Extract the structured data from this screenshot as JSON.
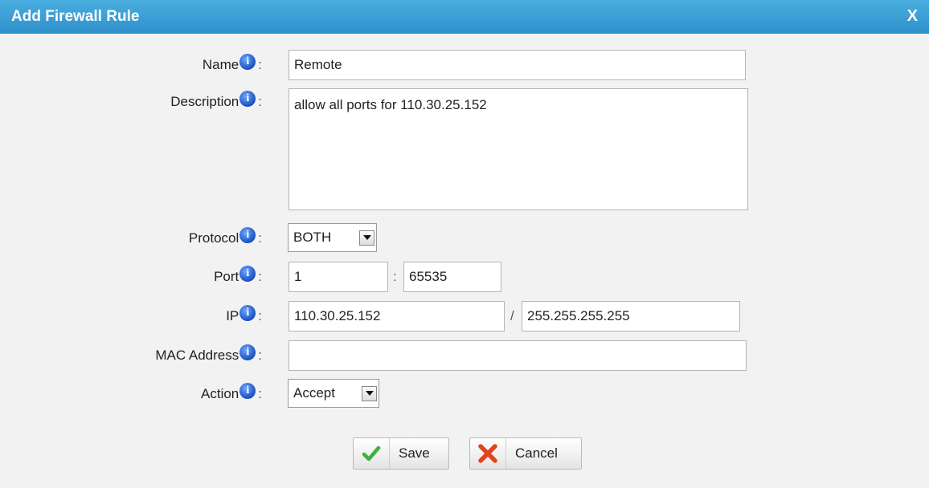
{
  "dialog": {
    "title": "Add Firewall Rule",
    "close_label": "X"
  },
  "form": {
    "name": {
      "label": "Name",
      "value": "Remote"
    },
    "description": {
      "label": "Description",
      "value": "allow all ports for 110.30.25.152"
    },
    "protocol": {
      "label": "Protocol",
      "value": "BOTH"
    },
    "port": {
      "label": "Port",
      "from": "1",
      "separator": ":",
      "to": "65535"
    },
    "ip": {
      "label": "IP",
      "address": "110.30.25.152",
      "separator": "/",
      "mask": "255.255.255.255"
    },
    "mac": {
      "label": "MAC Address",
      "value": ""
    },
    "action": {
      "label": "Action",
      "value": "Accept"
    },
    "info_glyph": "i",
    "colon": ":"
  },
  "buttons": {
    "save_label": "Save",
    "cancel_label": "Cancel"
  },
  "colors": {
    "title_bar": "#3a9fd8",
    "background": "#f2f2f2",
    "save_icon": "#3db13d",
    "cancel_icon": "#e0451e",
    "info_icon": "#2b62d6"
  }
}
